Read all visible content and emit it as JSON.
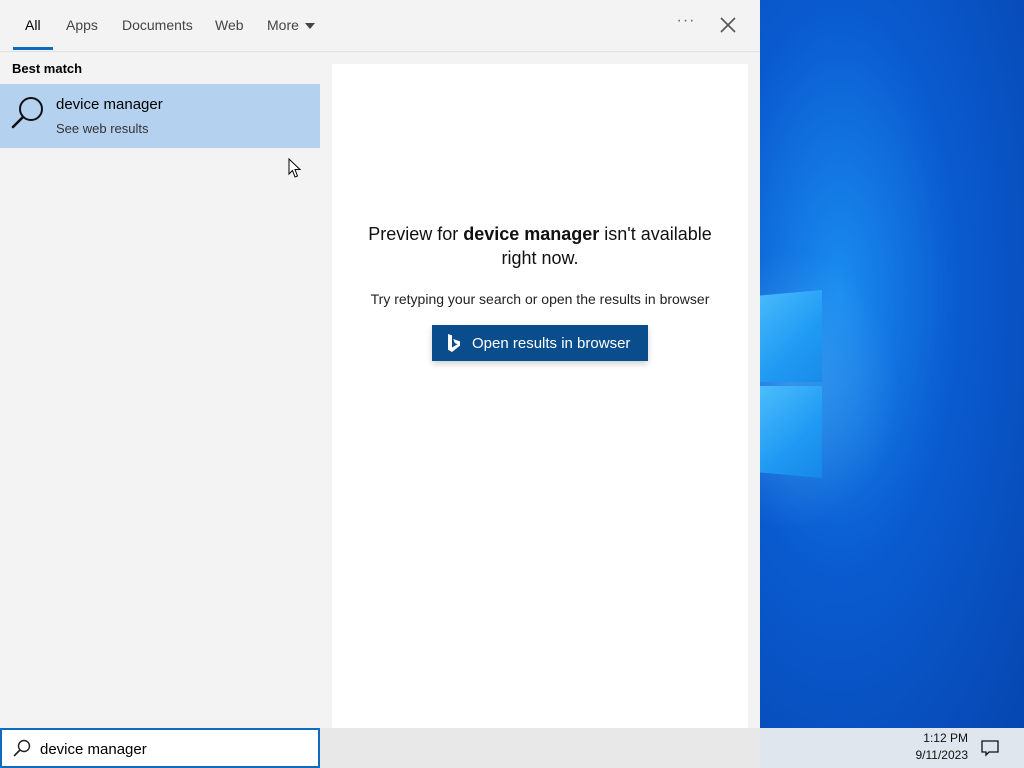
{
  "tabs": [
    {
      "label": "All",
      "active": true
    },
    {
      "label": "Apps"
    },
    {
      "label": "Documents"
    },
    {
      "label": "Web"
    },
    {
      "label": "More"
    }
  ],
  "best_match": {
    "label": "Best match",
    "title": "device manager",
    "subtitle": "See web results"
  },
  "preview": {
    "msg_prefix": "Preview for ",
    "msg_term": "device manager",
    "msg_suffix": " isn't available right now.",
    "hint": "Try retyping your search or open the results in browser",
    "button_label": "Open results in browser"
  },
  "search": {
    "value": "device manager"
  },
  "clock": {
    "time": "1:12 PM",
    "date": "9/11/2023"
  },
  "colors": {
    "accent": "#0f6cbd",
    "selected_row": "#b4d2ef",
    "button": "#0a4d8c"
  },
  "icons": {
    "more": "chevron-down-icon",
    "options": "ellipsis-icon",
    "close": "close-icon",
    "result": "search-icon",
    "button": "bing-icon",
    "notifications": "notification-icon"
  }
}
